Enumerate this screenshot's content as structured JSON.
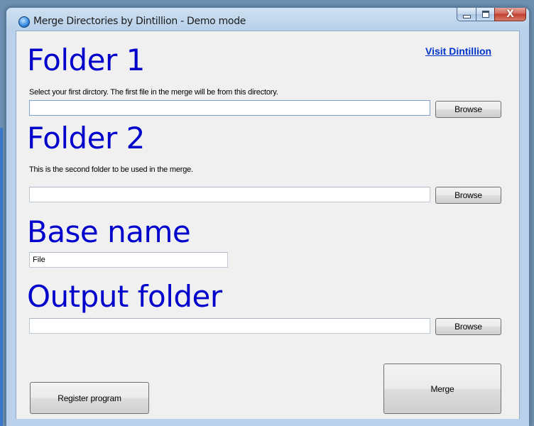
{
  "window": {
    "title": "Merge Directories by Dintillion - Demo mode",
    "close_symbol": "X"
  },
  "header": {
    "visit_link": "Visit Dintillion"
  },
  "folder1": {
    "heading": "Folder 1",
    "hint": "Select your first dirctory. The first file in the merge will be from this directory.",
    "value": "",
    "browse_label": "Browse"
  },
  "folder2": {
    "heading": "Folder 2",
    "hint": "This is the second folder to be used in the merge.",
    "value": "",
    "browse_label": "Browse"
  },
  "base_name": {
    "heading": "Base name",
    "value": "File"
  },
  "output_folder": {
    "heading": "Output folder",
    "value": "",
    "browse_label": "Browse"
  },
  "actions": {
    "register_label": "Register program",
    "merge_label": "Merge"
  },
  "colors": {
    "heading": "#0000cc",
    "link": "#0033cc",
    "client_bg": "#f0f0f0"
  }
}
